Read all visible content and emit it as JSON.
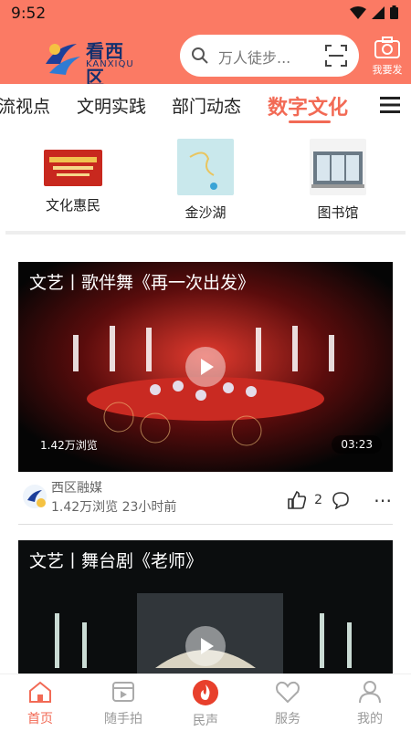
{
  "status_bar": {
    "time": "9:52"
  },
  "header": {
    "logo_title": "看西区",
    "logo_subtitle": "KANXIQU",
    "search_placeholder": "万人徒步...",
    "publish_label": "我要发"
  },
  "tabs": [
    {
      "label": "流视点"
    },
    {
      "label": "文明实践"
    },
    {
      "label": "部门动态"
    },
    {
      "label": "数字文化",
      "active": true
    }
  ],
  "shortcuts": [
    {
      "label": "文化惠民",
      "icon": "culture-banner-thumb"
    },
    {
      "label": "金沙湖",
      "icon": "jinsha-lake-thumb"
    },
    {
      "label": "图书馆",
      "icon": "library-thumb"
    }
  ],
  "feed": [
    {
      "title": "文艺丨歌伴舞《再一次出发》",
      "views_overlay": "1.42万浏览",
      "duration": "03:23",
      "source": "西区融媒",
      "info": "1.42万浏览 23小时前",
      "likes": "2"
    },
    {
      "title": "文艺丨舞台剧《老师》"
    }
  ],
  "bottom_nav": [
    {
      "label": "首页",
      "active": true
    },
    {
      "label": "随手拍"
    },
    {
      "label": "民声"
    },
    {
      "label": "服务"
    },
    {
      "label": "我的"
    }
  ],
  "colors": {
    "header_bg": "#fb7a64",
    "accent": "#f26a55",
    "logo_blue": "#14306e"
  }
}
